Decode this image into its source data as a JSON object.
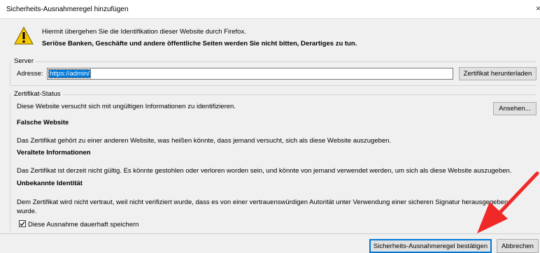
{
  "window": {
    "title": "Sicherheits-Ausnahmeregel hinzufügen",
    "close_glyph": "×"
  },
  "warning": {
    "line1": "Hiermit übergehen Sie die Identifikation dieser Website durch Firefox.",
    "line2": "Seriöse Banken, Geschäfte und andere öffentliche Seiten werden Sie nicht bitten, Derartiges zu tun."
  },
  "server": {
    "group_label": "Server",
    "address_label": "Adresse:",
    "address_value": "https://admin/",
    "download_button": "Zertifikat herunterladen"
  },
  "cert_status": {
    "group_label": "Zertifikat-Status",
    "summary": "Diese Website versucht sich mit ungültigen Informationen zu identifizieren.",
    "view_button": "Ansehen...",
    "sections": [
      {
        "heading": "Falsche Website",
        "text": "Das Zertifikat gehört zu einer anderen Website, was heißen könnte, dass jemand versucht, sich als diese Website auszugeben."
      },
      {
        "heading": "Veraltete Informationen",
        "text": "Das Zertifikat ist derzeit nicht gültig. Es könnte gestohlen oder verloren worden sein, und könnte von jemand verwendet werden, um sich als diese Website auszugeben."
      },
      {
        "heading": "Unbekannte Identität",
        "text_line1": "Dem Zertifikat wird nicht vertraut, weil nicht verifiziert wurde, dass es von einer vertrauenswürdigen Autorität unter Verwendung einer sicheren Signatur herausgegeben",
        "text_line2": "wurde."
      }
    ]
  },
  "permanent": {
    "label": "Diese Ausnahme dauerhaft speichern",
    "checked": true
  },
  "footer": {
    "confirm_button": "Sicherheits-Ausnahmeregel bestätigen",
    "cancel_button": "Abbrechen"
  },
  "colors": {
    "selection": "#0078d7",
    "arrow": "#f02828",
    "warning_yellow": "#f7c800"
  },
  "icons": {
    "warning": "warning-triangle-icon",
    "checkbox": "checkmark-icon",
    "annotation": "red-arrow-icon"
  }
}
